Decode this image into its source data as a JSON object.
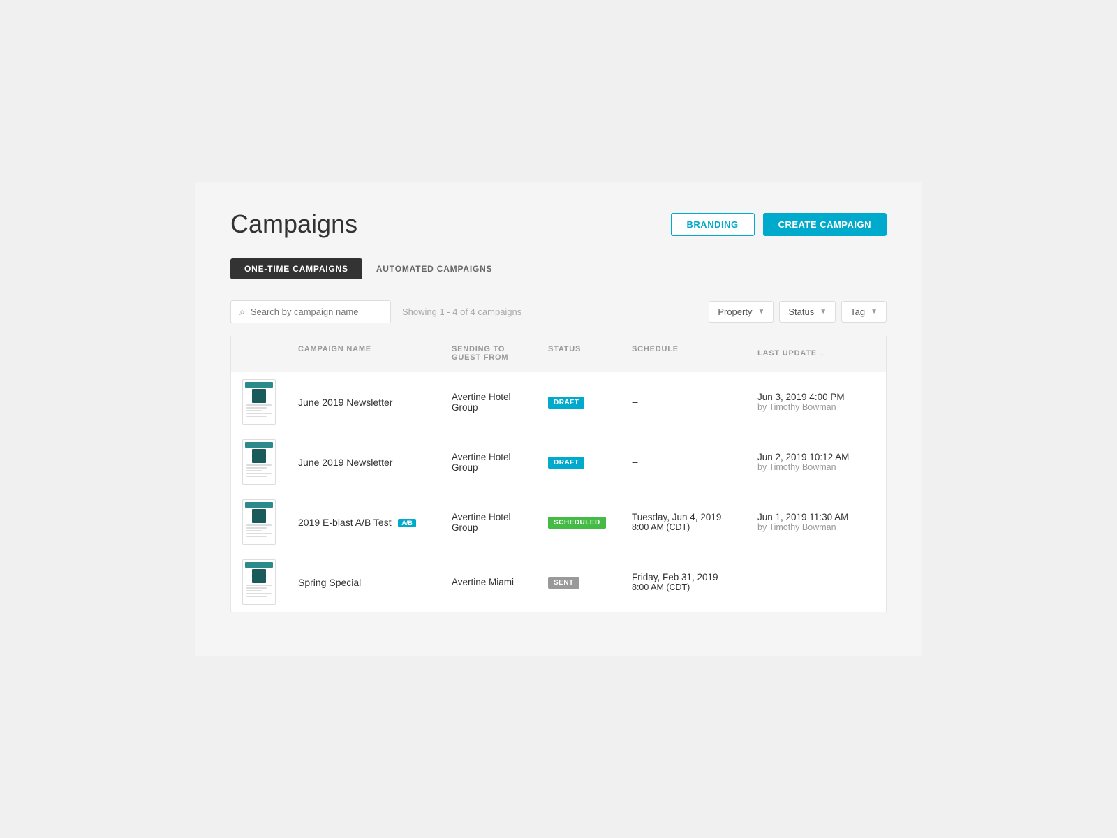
{
  "page": {
    "title": "Campaigns",
    "tabs": [
      {
        "id": "one-time",
        "label": "ONE-TIME CAMPAIGNS",
        "active": true
      },
      {
        "id": "automated",
        "label": "AUTOMATED CAMPAIGNS",
        "active": false
      }
    ],
    "header_buttons": {
      "branding": "BRANDING",
      "create": "CREATE CAMPAIGN"
    }
  },
  "filters": {
    "search_placeholder": "Search by campaign name",
    "showing_text": "Showing 1 - 4 of 4 campaigns",
    "property_label": "Property",
    "status_label": "Status",
    "tag_label": "Tag"
  },
  "table": {
    "columns": [
      {
        "id": "thumbnail",
        "label": ""
      },
      {
        "id": "campaign_name",
        "label": "CAMPAIGN NAME"
      },
      {
        "id": "sending_to",
        "label": "SENDING TO GUEST FROM"
      },
      {
        "id": "status",
        "label": "STATUS"
      },
      {
        "id": "schedule",
        "label": "SCHEDULE"
      },
      {
        "id": "last_update",
        "label": "LAST UPDATE"
      }
    ],
    "rows": [
      {
        "id": "row-1",
        "campaign_name": "June 2019 Newsletter",
        "ab_test": false,
        "sending_to": "Avertine Hotel Group",
        "status": "DRAFT",
        "status_type": "draft",
        "schedule": "--",
        "last_update_main": "Jun 3, 2019 4:00 PM",
        "last_update_sub": "by Timothy Bowman"
      },
      {
        "id": "row-2",
        "campaign_name": "June 2019 Newsletter",
        "ab_test": false,
        "sending_to": "Avertine Hotel Group",
        "status": "DRAFT",
        "status_type": "draft",
        "schedule": "--",
        "last_update_main": "Jun 2, 2019 10:12 AM",
        "last_update_sub": "by Timothy Bowman"
      },
      {
        "id": "row-3",
        "campaign_name": "2019 E-blast A/B Test",
        "ab_test": true,
        "ab_label": "A/B",
        "sending_to": "Avertine Hotel Group",
        "status": "SCHEDULED",
        "status_type": "scheduled",
        "schedule_main": "Tuesday, Jun 4, 2019",
        "schedule_sub": "8:00 AM (CDT)",
        "last_update_main": "Jun 1, 2019 11:30 AM",
        "last_update_sub": "by Timothy Bowman"
      },
      {
        "id": "row-4",
        "campaign_name": "Spring Special",
        "ab_test": false,
        "sending_to": "Avertine Miami",
        "status": "SENT",
        "status_type": "sent",
        "schedule_main": "Friday, Feb 31, 2019",
        "schedule_sub": "8:00 AM (CDT)",
        "last_update_main": "",
        "last_update_sub": ""
      }
    ]
  }
}
